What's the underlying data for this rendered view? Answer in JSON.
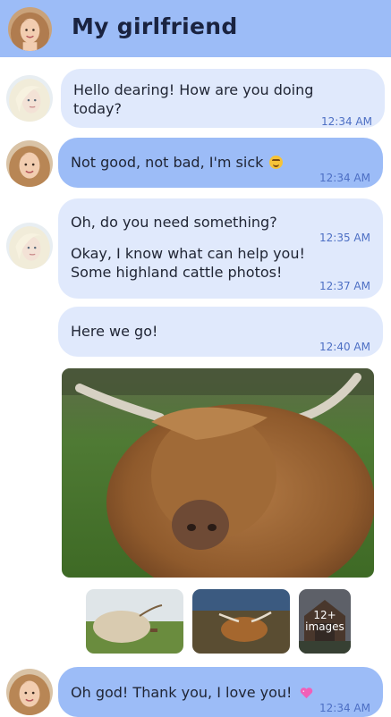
{
  "header": {
    "title": "My girlfriend",
    "avatar_icon": "girlfriend-avatar"
  },
  "messages": [
    {
      "sender": "girlfriend",
      "lines": [
        "Hello dearing! How are you doing",
        "today?"
      ],
      "time": "12:34 AM"
    },
    {
      "sender": "me",
      "text": "Not good, not bad, I'm sick",
      "emoji": "smiling-face-icon",
      "time": "12:34 AM"
    },
    {
      "sender": "girlfriend",
      "text": "Oh, do you need something?",
      "time": "12:35 AM"
    },
    {
      "sender": "girlfriend",
      "lines": [
        "Okay, I know what can help you!",
        "Some highland cattle photos!"
      ],
      "time": "12:37 AM"
    },
    {
      "sender": "girlfriend",
      "text": "Here we go!",
      "time": "12:40 AM"
    },
    {
      "sender": "me",
      "text": "Oh god! Thank you, I love you!",
      "emoji": "pink-heart-icon",
      "time": "12:34 AM"
    }
  ],
  "photos": {
    "main": "highland-cow-closeup-photo",
    "thumbnails": [
      "highland-cow-field-photo",
      "highland-cow-lying-photo",
      "barn-photo"
    ],
    "more_count": "12+",
    "more_label": "images"
  },
  "colors": {
    "header": "#9cbcf7",
    "her_bubble": "#e0e9fc",
    "my_bubble": "#9cbcf7",
    "time_text": "#4d6fc4"
  }
}
